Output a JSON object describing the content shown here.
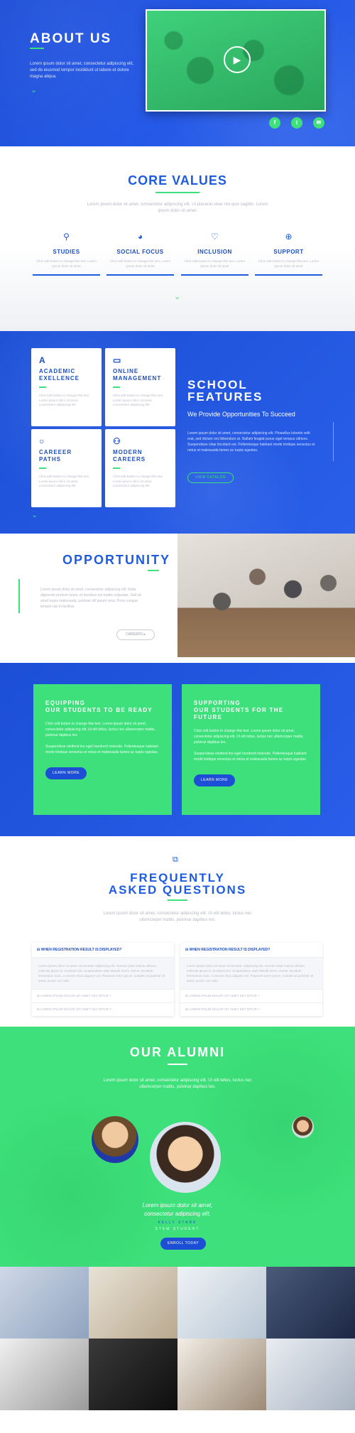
{
  "hero": {
    "title": "ABOUT US",
    "text": "Lorem ipsum dolor sit amet, consectetur adipiscing elit, sed do eiusmod tempor incididunt ut labore et dolore magna aliqua.",
    "social": [
      "f",
      "t",
      "✉"
    ]
  },
  "core": {
    "title": "CORE VALUES",
    "intro": "Lorem ipsum dolor sit amet, consectetur adipiscing elit. Ut placerat vitae nisl quis sagittis. Lorem ipsum dolor sit amet.",
    "items": [
      {
        "name": "STUDIES",
        "icon": "pin-icon",
        "desc": "Click edit button to change this text. Lorem ipsum dolor sit amet"
      },
      {
        "name": "SOCIAL FOCUS",
        "icon": "globe-icon",
        "desc": "Click edit button to change this text. Lorem ipsum dolor sit amet"
      },
      {
        "name": "INCLUSION",
        "icon": "heart-icon",
        "desc": "Click edit button to change this text. Lorem ipsum dolor sit amet"
      },
      {
        "name": "SUPPORT",
        "icon": "support-icon",
        "desc": "Click edit button to change this text. Lorem ipsum dolor sit amet"
      }
    ]
  },
  "features": {
    "cards": [
      {
        "name_1": "ACADEMIC",
        "name_2": "EXELLENCE",
        "icon": "A",
        "desc": "Click edit button to change this text. Lorem ipsum dolor sit amet, consectetur adipiscing elit."
      },
      {
        "name_1": "ONLINE",
        "name_2": "MANAGEMENT",
        "icon": "▭",
        "desc": "Click edit button to change this text. Lorem ipsum dolor sit amet, consectetur adipiscing elit."
      },
      {
        "name_1": "CAREEER",
        "name_2": "PATHS",
        "icon": "○",
        "desc": "Click edit button to change this text. Lorem ipsum dolor sit amet, consectetur adipiscing elit."
      },
      {
        "name_1": "MODERN",
        "name_2": "CAREERS",
        "icon": "⚇",
        "desc": "Click edit button to change this text. Lorem ipsum dolor sit amet, consectetur adipiscing elit."
      }
    ],
    "title_1": "SCHOOL",
    "title_2": "FEATURES",
    "subtitle": "We Provide Opportunities To Succeed",
    "text": "Lorem ipsum dolor sit amet, consectetur adipiscing elit. Phasellus lobortis velit erat, sed dictum orci bibendum ut. Nullam feugiat purus eget tempus ultrices. Suspendisse vitae tincidunt est. Pellentesque habitant morbi tristique senectus et netus et malesuada fames ac turpis egestas.",
    "button": "VIEW CATALOG"
  },
  "opportunity": {
    "title": "OPPORTUNITY",
    "text": "Lorem ipsum dolor sit amet, consectetur adipiscing elit. Nulla dignissim pretium turpis, id faucibus est mattis vulputate. Sed sit amet turpis malesuada, pulvinar elit ipsum urna. Proin congue tempor nisi in facilisis.",
    "button": "CAREERS ▸"
  },
  "equip": {
    "cards": [
      {
        "title_1": "EQUIPPING",
        "title_2": "OUR STUDENTS TO BE READY",
        "p1": "Click edit button to change this text. Lorem ipsum dolor sit amet, consectetur adipiscing elit. Ut elit tellus, luctus nec ullamcorper mattis, pulvinar dapibus leo.",
        "p2": "Suspendisse eleifend leo eget hendrerit molestie. Pellentesque habitant morbi tristique senectus et netus et malesuada fames ac turpis egestas.",
        "button": "LEARN MORE"
      },
      {
        "title_1": "SUPPORTING",
        "title_2": "OUR STUDENTS FOR THE FUTURE",
        "p1": "Click edit button to change this text. Lorem ipsum dolor sit amet, consectetur adipiscing elit. Ut elit tellus, luctus nec ullamcorper mattis, pulvinar dapibus leo.",
        "p2": "Suspendisse eleifend leo eget hendrerit molestie. Pellentesque habitant morbi tristique senectus et netus et malesuada fames ac turpis egestas.",
        "button": "LEARN MORE"
      }
    ]
  },
  "faq": {
    "title_1": "FREQUENTLY",
    "title_2": "ASKED QUESTIONS",
    "intro": "Lorem ipsum dolor sit amet, consectetur adipiscing elit. Ut elit tellus, luctus nec ullamcorper mattis, pulvinar dapibus leo.",
    "columns": [
      {
        "question": "WHEN REGISTRATION RESULT IS DISPLAYED?",
        "answer": "Lorem ipsum dolor sit amet consectetur adipiscing elit. Aenean vitae massa ultrices, vehicula ipsum in, tincidunt nisi. Suspendisse vitae blandit lorem. Donec tincidunt fermentum nunc, a viverra risus aliquam vel. Praesent tortor ipsum, sodales at pulvinar sit amet, auctor non odio.",
        "rows": [
          "LOREM IPSUM DOLOR SIT AMET SECTETUR ?",
          "LOREM IPSUM DOLOR SIT AMET SECTETUR ?"
        ]
      },
      {
        "question": "WHEN REGISTRATION RESULT IS DISPLAYED?",
        "answer": "Lorem ipsum dolor sit amet consectetur adipiscing elit. Aenean vitae massa ultrices, vehicula ipsum in, tincidunt nisi. Suspendisse vitae blandit lorem. Donec tincidunt fermentum nunc, a viverra risus aliquam vel. Praesent tortor ipsum, sodales at pulvinar sit amet, auctor non odio.",
        "rows": [
          "LOREM IPSUM DOLOR SIT AMET SECTETUR ?",
          "LOREM IPSUM DOLOR SIT AMET SECTETUR ?"
        ]
      }
    ]
  },
  "alumni": {
    "title": "OUR ALUMNI",
    "intro": "Lorem ipsum dolor sit amet, consectetur adipiscing elit. Ut elit tellus, luctus nec ullamcorper mattis, pulvinar dapibus leo.",
    "quote_1": "Lorem ipsum dolor sit amet,",
    "quote_2": "consectetur adipiscing elit.",
    "name": "KELLY STARK",
    "role": "STEM STUDENT",
    "button": "ENROLL TODAY"
  },
  "colors": {
    "blue": "#1f52dc",
    "green": "#3de07a",
    "title_blue": "#1d5be0"
  }
}
